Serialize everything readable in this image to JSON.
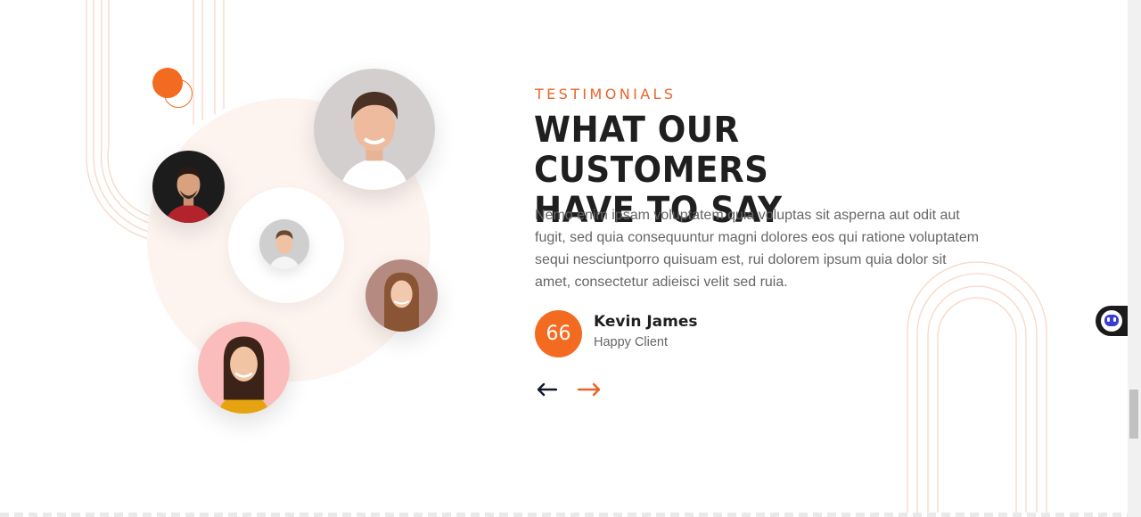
{
  "section": {
    "eyebrow": "TESTIMONIALS",
    "title_line1": "WHAT OUR CUSTOMERS",
    "title_line2": "HAVE TO SAY",
    "body": "Nemo enim ipsam voluptatem quia voluptas sit asperna aut odit aut fugit, sed quia consequuntur magni dolores eos qui ratione voluptatem sequi nesciuntporro quisuam est, rui dolorem ipsum quia dolor sit amet, consectetur adieisci velit sed ruia."
  },
  "testimonial": {
    "quote_mark": "66",
    "client_name": "Kevin James",
    "client_role": "Happy Client"
  },
  "navigation": {
    "prev_icon": "arrow-left-icon",
    "next_icon": "arrow-right-icon"
  },
  "avatars": [
    {
      "name": "avatar-man-large",
      "bg": "#d3cfcf"
    },
    {
      "name": "avatar-man-dark",
      "bg": "#1c1c1c"
    },
    {
      "name": "avatar-boy-small",
      "bg": "#cfcfcf"
    },
    {
      "name": "avatar-woman-brown",
      "bg": "#b58a80"
    },
    {
      "name": "avatar-woman-pink",
      "bg": "#fbbcbc"
    }
  ],
  "chat_widget": {
    "icon": "chatbot-icon"
  },
  "colors": {
    "accent": "#f36b21",
    "heading": "#1f1f1f",
    "body": "#666666",
    "arch": "#f7d7c8",
    "glow": "#fdf3ef"
  }
}
